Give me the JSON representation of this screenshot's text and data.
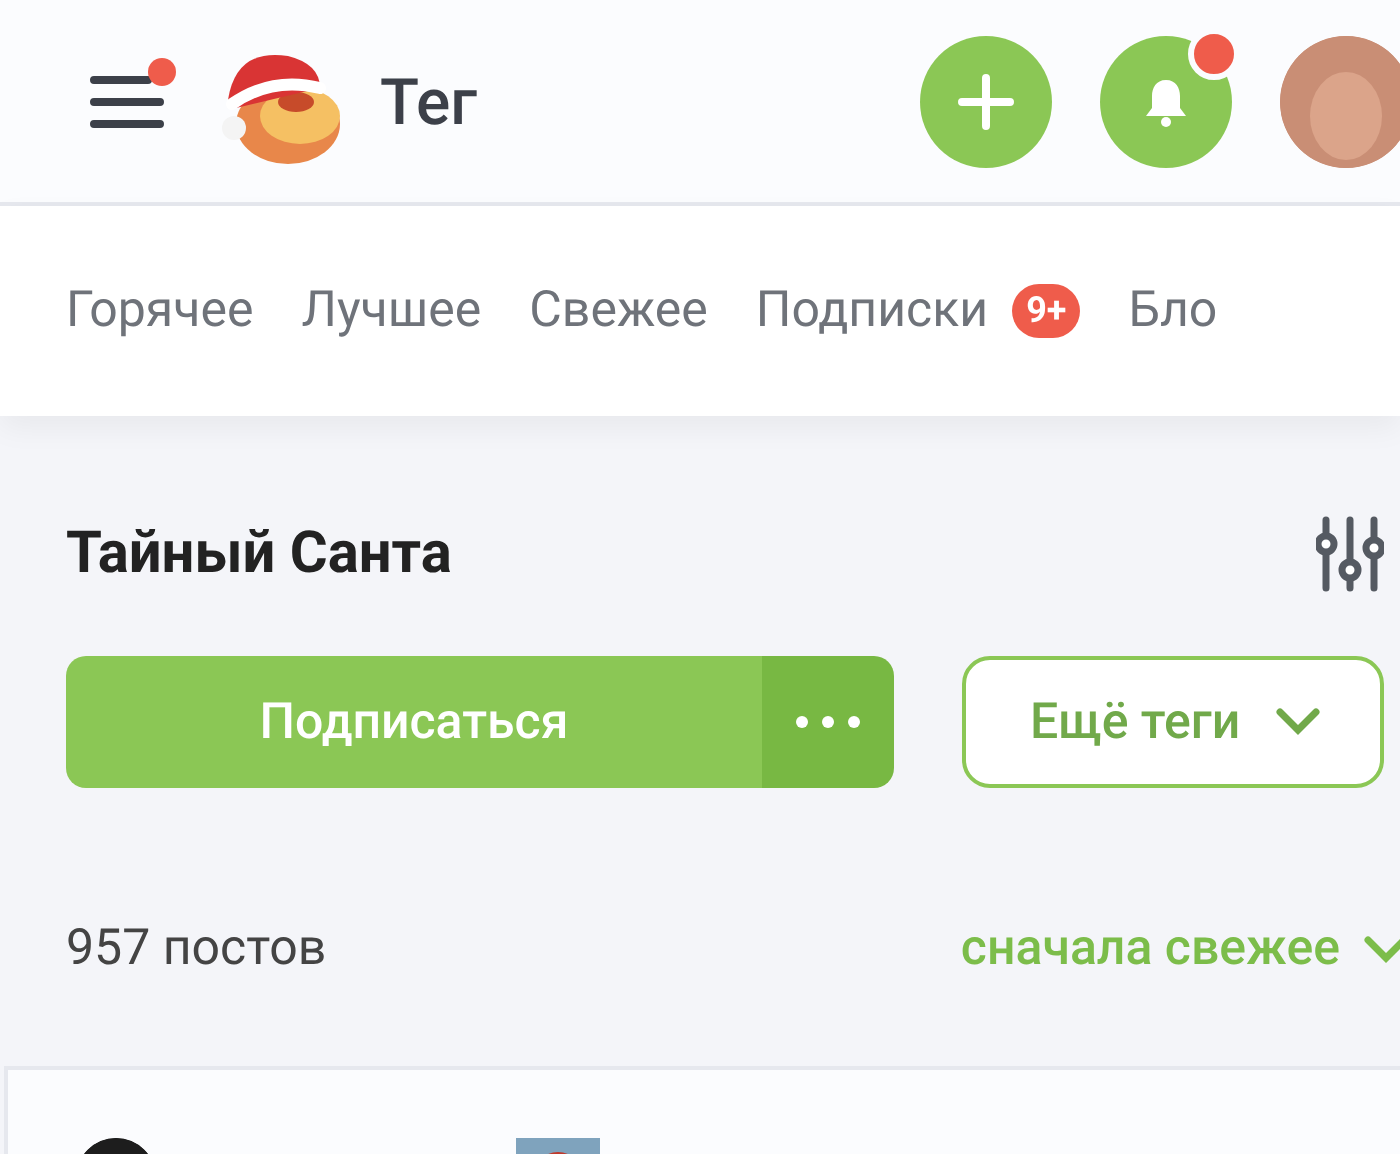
{
  "header": {
    "title": "Тег",
    "menu_has_notification": true,
    "bell_has_notification": true
  },
  "tabs": [
    {
      "label": "Горячее",
      "selected": false
    },
    {
      "label": "Лучшее",
      "selected": false
    },
    {
      "label": "Свежее",
      "selected": false
    },
    {
      "label": "Подписки",
      "selected": false,
      "badge": "9+"
    },
    {
      "label": "Бло",
      "selected": false
    }
  ],
  "tag": {
    "title": "Тайный Санта",
    "subscribe_button": "Подписаться",
    "more_tags_button": "Ещё теги"
  },
  "posts": {
    "count": "957 постов",
    "sort": "сначала свежее"
  }
}
